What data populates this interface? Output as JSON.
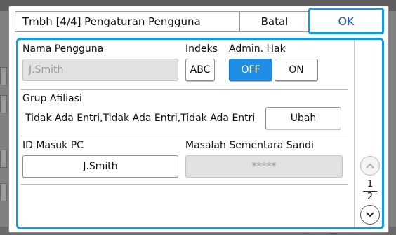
{
  "dialog": {
    "title": "Tmbh [4/4] Pengaturan Pengguna",
    "cancel_label": "Batal",
    "ok_label": "OK"
  },
  "user": {
    "name_label": "Nama Pengguna",
    "name_value": "J.Smith",
    "index_label": "Indeks",
    "index_value": "ABC",
    "admin_label": "Admin. Hak",
    "admin_off": "OFF",
    "admin_on": "ON",
    "admin_selected": "OFF"
  },
  "group": {
    "label": "Grup Afiliasi",
    "value": "Tidak Ada Entri,Tidak Ada Entri,Tidak Ada Entri",
    "change_label": "Ubah"
  },
  "pc": {
    "login_label": "ID Masuk PC",
    "login_value": "J.Smith",
    "temp_password_label": "Masalah Sementara Sandi",
    "temp_password_value": "*****"
  },
  "pager": {
    "current": "1",
    "total": "2"
  },
  "colors": {
    "accent": "#0a9ee0",
    "active_button": "#1f8fe6"
  }
}
